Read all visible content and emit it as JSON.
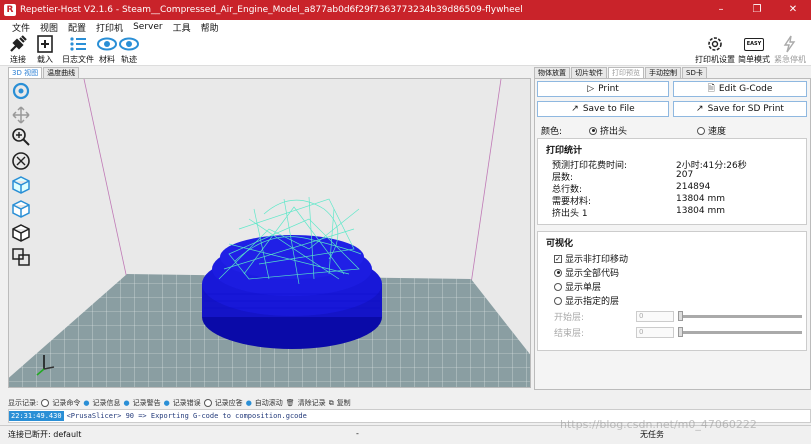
{
  "window": {
    "title": "Repetier-Host V2.1.6 - Steam__Compressed_Air_Engine_Model_a877ab0d6f29f7363773234b39d86509-flywheel",
    "min": "–",
    "restore": "❐",
    "close": "✕"
  },
  "menu": [
    "文件",
    "视图",
    "配置",
    "打印机",
    "Server",
    "工具",
    "帮助"
  ],
  "toolbar": {
    "connect": "连接",
    "load": "载入",
    "log": "日志文件",
    "material": "材料",
    "path": "轨迹",
    "printer_settings": "打印机设置",
    "easy_mode": "简单模式",
    "easy_badge": "EASY",
    "emergency": "紧急停机"
  },
  "view_tabs": [
    "3D 视图",
    "温度曲线"
  ],
  "panel_tabs": [
    "物体放置",
    "切片软件",
    "打印预览",
    "手动控制",
    "SD卡"
  ],
  "preview": {
    "print": "Print",
    "edit_gcode": "Edit G-Code",
    "save_file": "Save to File",
    "save_sd": "Save for SD Print",
    "color_label": "颜色:",
    "color_opt1": "挤出头",
    "color_opt2": "速度",
    "stats_title": "打印统计",
    "stats": [
      {
        "label": "预测打印花费时间:",
        "value": "2小时:41分:26秒"
      },
      {
        "label": "层数:",
        "value": "207"
      },
      {
        "label": "总行数:",
        "value": "214894"
      },
      {
        "label": "需要材料:",
        "value": "13804 mm"
      },
      {
        "label": "挤出头 1",
        "value": "13804 mm"
      }
    ],
    "vis_title": "可视化",
    "vis_show_travel": "显示非打印移动",
    "vis_all": "显示全部代码",
    "vis_single": "显示单层",
    "vis_range": "显示指定的层",
    "start_layer": "开始层:",
    "end_layer": "结束层:",
    "start_val": "0",
    "end_val": "0"
  },
  "log_filter": {
    "label": "显示记录:",
    "commands": "记录命令",
    "info": "记录信息",
    "warnings": "记录警告",
    "errors": "记录错误",
    "ack": "记录应答",
    "autoscroll": "自动滚动",
    "clear": "清除记录",
    "copy": "复制"
  },
  "log_line": {
    "time": "22:31:49.430",
    "msg": "<PrusaSlicer> 90 => Exporting G-code to composition.gcode"
  },
  "status": {
    "left": "连接已断开: default",
    "dash": "-",
    "center": "无任务"
  },
  "watermark": "https://blog.csdn.net/m0_47060222",
  "colors": {
    "title_bar": "#c9232a",
    "model_blue": "#1010d0",
    "toolpath_cyan": "#58e8c8",
    "bed": "#8a9ea2",
    "accent": "#2a8fd6"
  }
}
